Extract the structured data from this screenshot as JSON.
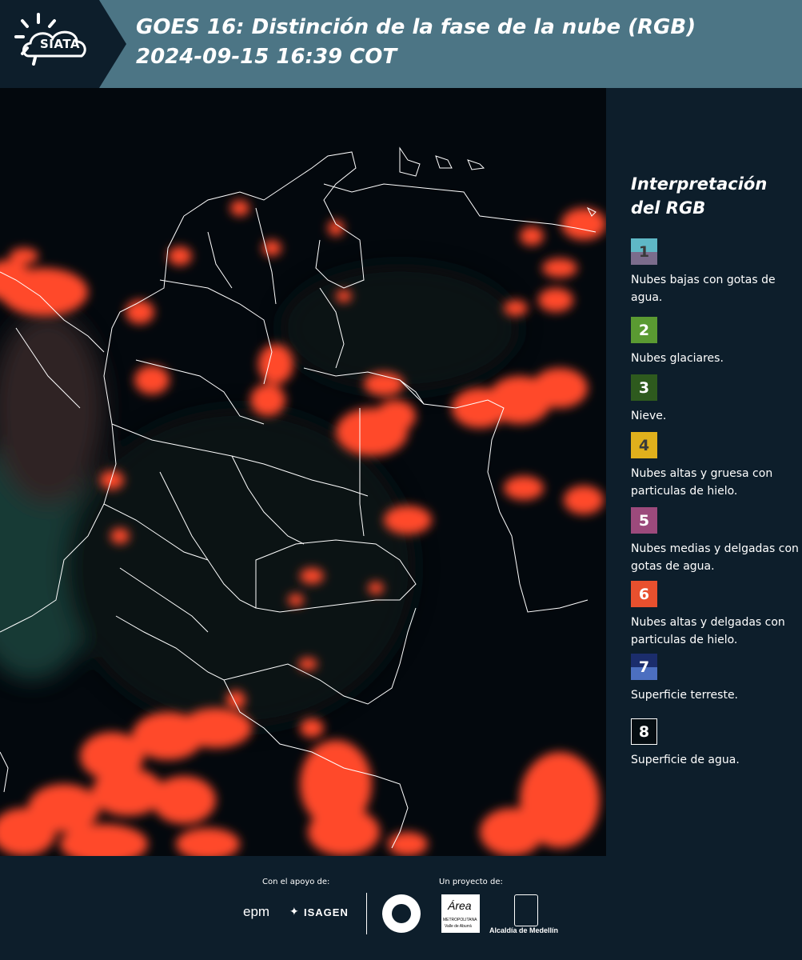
{
  "header": {
    "logo_text": "SIATA",
    "title_line1": "GOES 16: Distinción de la fase de la nube (RGB)",
    "title_line2": " 2024-09-15 16:39 COT"
  },
  "legend": {
    "title": "Interpretación del RGB",
    "items": [
      {
        "num": "1",
        "label": "Nubes bajas con gotas de agua.",
        "color_top": "#5fb8c6",
        "color_bottom": "#7b6c8c"
      },
      {
        "num": "2",
        "label": "Nubes glaciares.",
        "color": "#5a9a32"
      },
      {
        "num": "3",
        "label": "Nieve.",
        "color": "#2e5a1e"
      },
      {
        "num": "4",
        "label": "Nubes altas y gruesa con particulas de hielo.",
        "color": "#e0b01c"
      },
      {
        "num": "5",
        "label": "Nubes medias y delgadas con gotas de agua.",
        "color": "#9c4a7c"
      },
      {
        "num": "6",
        "label": "Nubes altas y delgadas con particulas de hielo.",
        "color": "#e8502e"
      },
      {
        "num": "7",
        "label": "Superficie terreste.",
        "color_top": "#1b2d6c",
        "color_bottom": "#4c6fc0"
      },
      {
        "num": "8",
        "label": "Superficie de agua.",
        "color": "#050d12"
      }
    ]
  },
  "footer": {
    "support_label": "Con el apoyo de:",
    "project_label": "Un proyecto de:",
    "sponsors": {
      "epm": "epm",
      "isagen": "ISAGEN",
      "metropolitana": "METROPOLITANA",
      "area": "Área",
      "valle": "Valle de Aburrá",
      "alcaldia": "Alcaldía de Medellín"
    }
  },
  "colors": {
    "header_bg": "#4c7585",
    "panel_bg": "#0d1e2b",
    "cloud_red": "#ff4a2a",
    "border_white": "#ffffff"
  }
}
